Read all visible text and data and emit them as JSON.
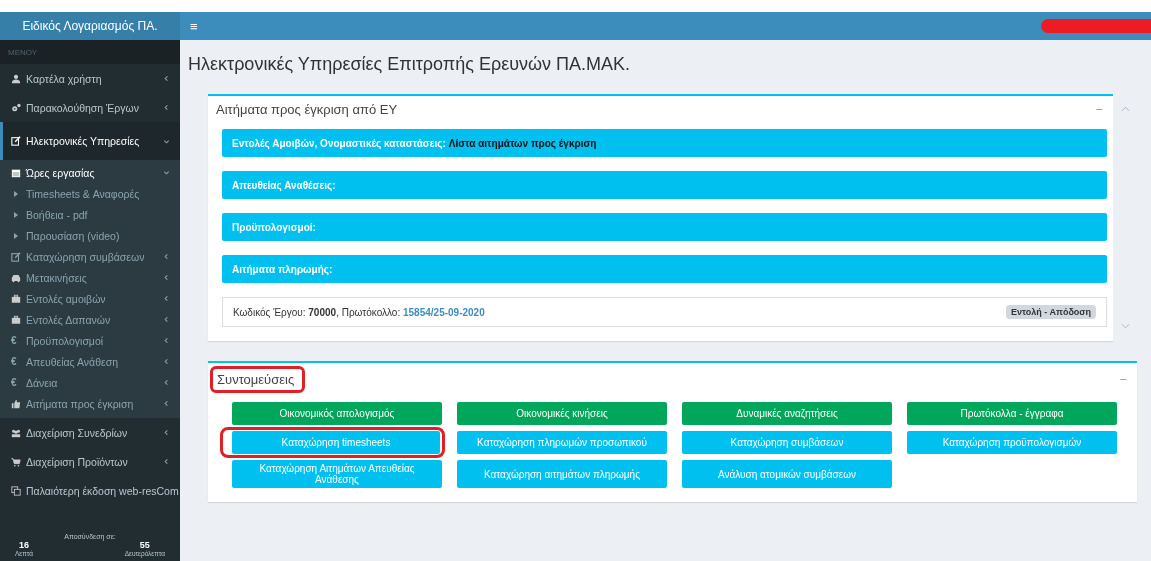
{
  "header": {
    "brand": "Ειδικός Λογαριασμός ΠΑ.",
    "menu_toggle": "≡"
  },
  "sidebar": {
    "menu_label": "ΜΕΝΟΥ",
    "items": [
      {
        "label": "Καρτέλα χρήστη",
        "kind": "menu",
        "expanded": false,
        "selected": false
      },
      {
        "label": "Παρακολούθηση Έργων",
        "kind": "menu",
        "expanded": false,
        "selected": false
      },
      {
        "label": "Ηλεκτρονικές Υπηρεσίες",
        "kind": "menu",
        "expanded": true,
        "selected": true,
        "children": [
          {
            "label": "Ώρες εργασίας",
            "kind": "menu",
            "expanded": true,
            "selected": true,
            "children": [
              {
                "label": "Timesheets & Αναφορές"
              },
              {
                "label": "Βοήθεια - pdf"
              },
              {
                "label": "Παρουσίαση (video)"
              }
            ]
          },
          {
            "label": "Καταχώρηση συμβάσεων",
            "kind": "menu",
            "expanded": false,
            "selected": false
          },
          {
            "label": "Μετακινήσεις",
            "kind": "menu",
            "expanded": false,
            "selected": false
          },
          {
            "label": "Εντολές αμοιβών",
            "kind": "menu",
            "expanded": false,
            "selected": false
          },
          {
            "label": "Εντολές Δαπανών",
            "kind": "menu",
            "expanded": false,
            "selected": false
          },
          {
            "label": "Προϋπολογισμοί",
            "kind": "menu",
            "glyph": "€",
            "expanded": false,
            "selected": false
          },
          {
            "label": "Απευθείας Ανάθεση",
            "kind": "menu",
            "glyph": "€",
            "expanded": false,
            "selected": false
          },
          {
            "label": "Δάνεια",
            "kind": "menu",
            "glyph": "€",
            "expanded": false,
            "selected": false
          },
          {
            "label": "Αιτήματα προς έγκριση",
            "kind": "menu",
            "expanded": false,
            "selected": false
          }
        ]
      },
      {
        "label": "Διαχείριση Συνεδρίων",
        "kind": "menu",
        "expanded": false,
        "selected": false
      },
      {
        "label": "Διαχείριση Προϊόντων",
        "kind": "menu",
        "expanded": false,
        "selected": false
      },
      {
        "label": "Παλαιότερη έκδοση web-resCom",
        "kind": "link"
      }
    ],
    "session": {
      "label": "Αποσύνδεση σε:",
      "minutes": "16",
      "minutes_label": "Λεπτά",
      "seconds": "55",
      "seconds_label": "Δευτερόλεπτα"
    }
  },
  "main": {
    "title": "Ηλεκτρονικές Υπηρεσίες Επιτροπής Ερευνών ΠΑ.ΜΑΚ.",
    "approvals": {
      "title": "Αιτήματα προς έγκριση από ΕΥ",
      "collapse": "−",
      "bars": [
        {
          "label": "Εντολές Αμοιβών, Ονομαστικές καταστάσεις:",
          "link": "Λίστα αιτημάτων προς έγκριση"
        },
        {
          "label": "Απευθείας Αναθέσεις:"
        },
        {
          "label": "Προϋπολογισμοί:"
        },
        {
          "label": "Αιτήματα πληρωμής:"
        }
      ],
      "record": {
        "text": "Κωδικός Έργου: **70000**, Πρωτόκολλο:",
        "link": "15854/25-09-2020",
        "badge": "Εντολή - Απόδοση"
      }
    },
    "shortcuts": {
      "title": "Συντομεύσεις",
      "highlighted": true,
      "collapse": "−",
      "buttons": [
        {
          "label": "Οικονομικός απολογισμός",
          "color": "#00a65a",
          "highlighted": false
        },
        {
          "label": "Οικονομικές κινήσεις",
          "color": "#00a65a",
          "highlighted": false
        },
        {
          "label": "Δυναμικές αναζητήσεις",
          "color": "#00a65a",
          "highlighted": false
        },
        {
          "label": "Πρωτόκολλα - έγγραφα",
          "color": "#00a65a",
          "highlighted": false
        },
        {
          "label": "Καταχώρηση timesheets",
          "color": "#00c0ef",
          "highlighted": true
        },
        {
          "label": "Καταχώρηση πληρωμών προσωπικού",
          "color": "#00c0ef",
          "highlighted": false
        },
        {
          "label": "Καταχώρηση συμβάσεων",
          "color": "#00c0ef",
          "highlighted": false
        },
        {
          "label": "Καταχώρηση προϋπολογισμών",
          "color": "#00c0ef",
          "highlighted": false
        },
        {
          "label": "Καταχώρηση Αιτημάτων Απευθείας Ανάθεσης",
          "color": "#00c0ef",
          "highlighted": false
        },
        {
          "label": "Καταχώρηση αιτημάτων πληρωμής",
          "color": "#00c0ef",
          "highlighted": false
        },
        {
          "label": "Ανάλυση ατομικών συμβάσεων",
          "color": "#00c0ef",
          "highlighted": false
        }
      ]
    }
  }
}
